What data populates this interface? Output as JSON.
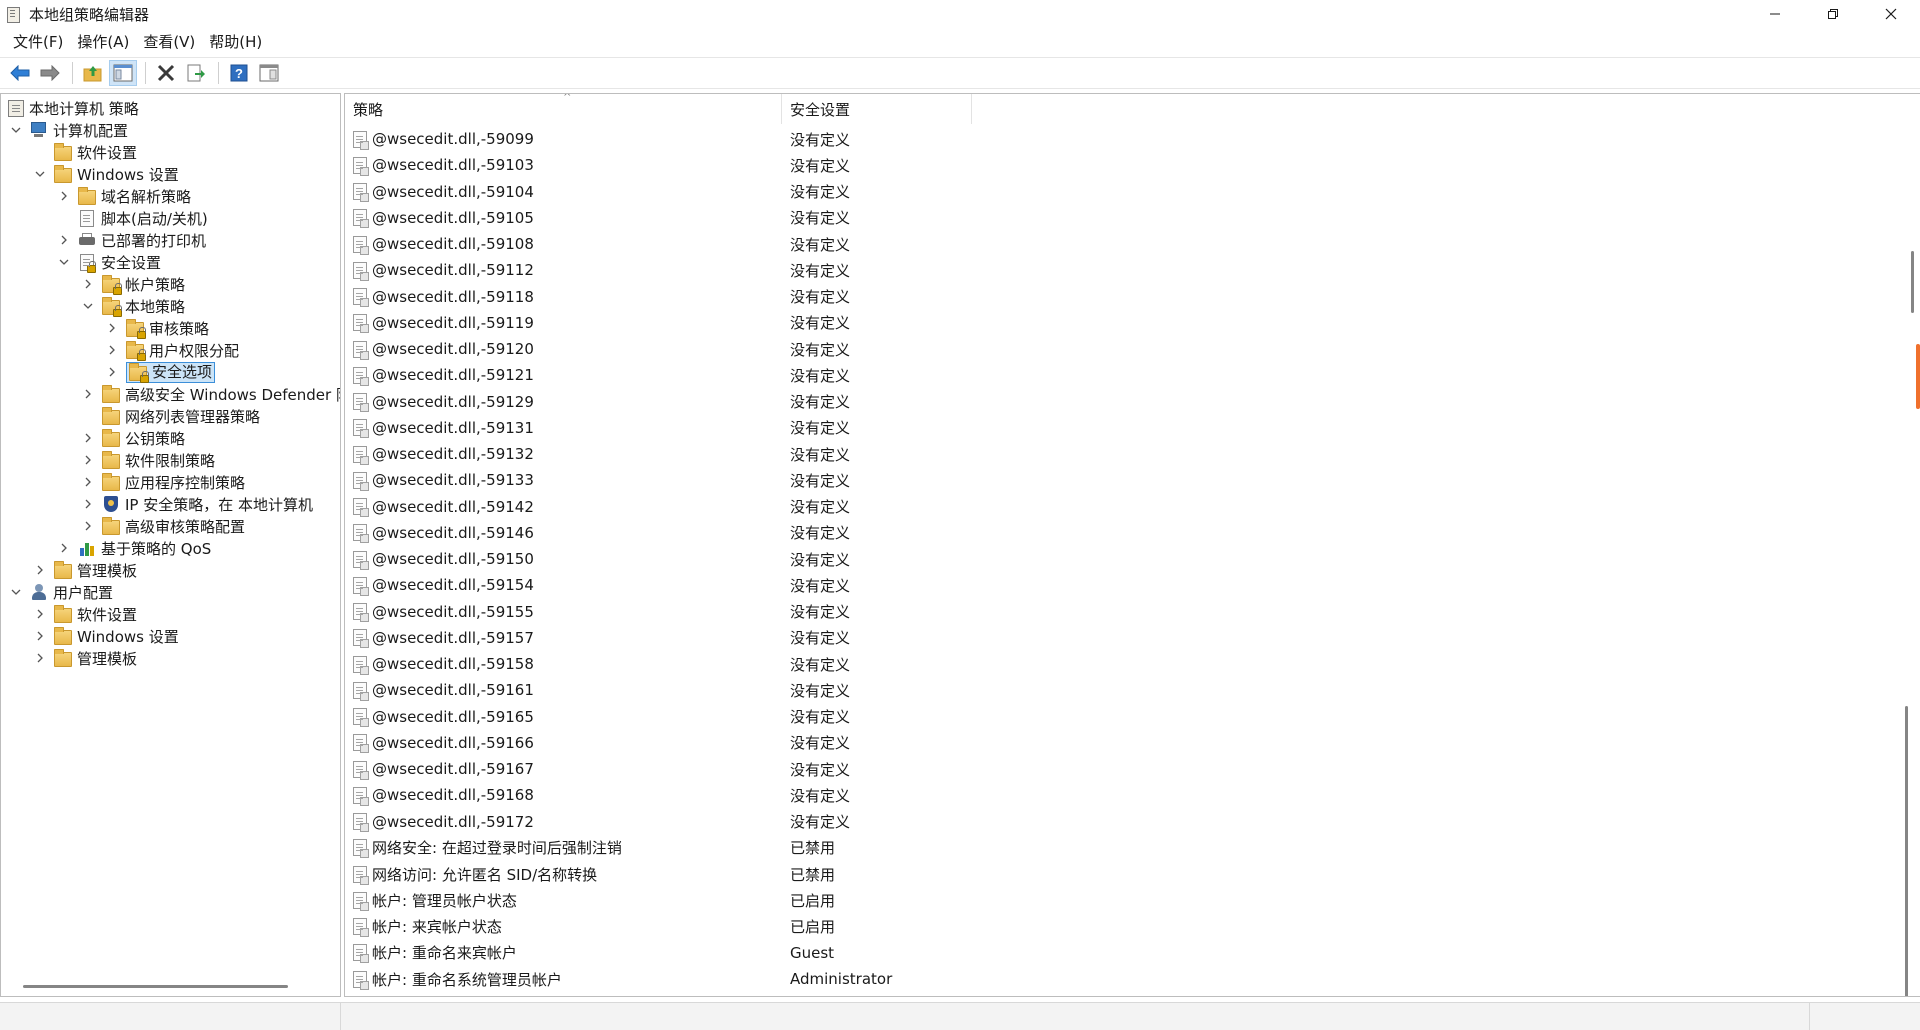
{
  "window": {
    "title": "本地组策略编辑器"
  },
  "menu": [
    {
      "label": "文件(F)"
    },
    {
      "label": "操作(A)"
    },
    {
      "label": "查看(V)"
    },
    {
      "label": "帮助(H)"
    }
  ],
  "toolbar": {
    "buttons": [
      "back-arrow-icon",
      "forward-arrow-icon",
      "up-folder-icon",
      "show-hide-tree-icon",
      "delete-icon",
      "export-list-icon",
      "help-icon",
      "properties-pane-icon"
    ]
  },
  "tree": {
    "items": [
      {
        "label": "本地计算机 策略"
      },
      {
        "label": "计算机配置"
      },
      {
        "label": "软件设置"
      },
      {
        "label": "Windows 设置"
      },
      {
        "label": "域名解析策略"
      },
      {
        "label": "脚本(启动/关机)"
      },
      {
        "label": "已部署的打印机"
      },
      {
        "label": "安全设置"
      },
      {
        "label": "帐户策略"
      },
      {
        "label": "本地策略"
      },
      {
        "label": "审核策略"
      },
      {
        "label": "用户权限分配"
      },
      {
        "label": "安全选项"
      },
      {
        "label": "高级安全 Windows Defender 防"
      },
      {
        "label": "网络列表管理器策略"
      },
      {
        "label": "公钥策略"
      },
      {
        "label": "软件限制策略"
      },
      {
        "label": "应用程序控制策略"
      },
      {
        "label": "IP 安全策略，在 本地计算机"
      },
      {
        "label": "高级审核策略配置"
      },
      {
        "label": "基于策略的 QoS"
      },
      {
        "label": "管理模板"
      },
      {
        "label": "用户配置"
      },
      {
        "label": "软件设置"
      },
      {
        "label": "Windows 设置"
      },
      {
        "label": "管理模板"
      }
    ]
  },
  "list": {
    "columns": {
      "policy": "策略",
      "setting": "安全设置"
    },
    "rows": [
      {
        "policy": "@wsecedit.dll,-59099",
        "setting": "没有定义"
      },
      {
        "policy": "@wsecedit.dll,-59103",
        "setting": "没有定义"
      },
      {
        "policy": "@wsecedit.dll,-59104",
        "setting": "没有定义"
      },
      {
        "policy": "@wsecedit.dll,-59105",
        "setting": "没有定义"
      },
      {
        "policy": "@wsecedit.dll,-59108",
        "setting": "没有定义"
      },
      {
        "policy": "@wsecedit.dll,-59112",
        "setting": "没有定义"
      },
      {
        "policy": "@wsecedit.dll,-59118",
        "setting": "没有定义"
      },
      {
        "policy": "@wsecedit.dll,-59119",
        "setting": "没有定义"
      },
      {
        "policy": "@wsecedit.dll,-59120",
        "setting": "没有定义"
      },
      {
        "policy": "@wsecedit.dll,-59121",
        "setting": "没有定义"
      },
      {
        "policy": "@wsecedit.dll,-59129",
        "setting": "没有定义"
      },
      {
        "policy": "@wsecedit.dll,-59131",
        "setting": "没有定义"
      },
      {
        "policy": "@wsecedit.dll,-59132",
        "setting": "没有定义"
      },
      {
        "policy": "@wsecedit.dll,-59133",
        "setting": "没有定义"
      },
      {
        "policy": "@wsecedit.dll,-59142",
        "setting": "没有定义"
      },
      {
        "policy": "@wsecedit.dll,-59146",
        "setting": "没有定义"
      },
      {
        "policy": "@wsecedit.dll,-59150",
        "setting": "没有定义"
      },
      {
        "policy": "@wsecedit.dll,-59154",
        "setting": "没有定义"
      },
      {
        "policy": "@wsecedit.dll,-59155",
        "setting": "没有定义"
      },
      {
        "policy": "@wsecedit.dll,-59157",
        "setting": "没有定义"
      },
      {
        "policy": "@wsecedit.dll,-59158",
        "setting": "没有定义"
      },
      {
        "policy": "@wsecedit.dll,-59161",
        "setting": "没有定义"
      },
      {
        "policy": "@wsecedit.dll,-59165",
        "setting": "没有定义"
      },
      {
        "policy": "@wsecedit.dll,-59166",
        "setting": "没有定义"
      },
      {
        "policy": "@wsecedit.dll,-59167",
        "setting": "没有定义"
      },
      {
        "policy": "@wsecedit.dll,-59168",
        "setting": "没有定义"
      },
      {
        "policy": "@wsecedit.dll,-59172",
        "setting": "没有定义"
      },
      {
        "policy": "网络安全: 在超过登录时间后强制注销",
        "setting": "已禁用"
      },
      {
        "policy": "网络访问: 允许匿名 SID/名称转换",
        "setting": "已禁用"
      },
      {
        "policy": "帐户: 管理员帐户状态",
        "setting": "已启用"
      },
      {
        "policy": "帐户: 来宾帐户状态",
        "setting": "已启用"
      },
      {
        "policy": "帐户: 重命名来宾帐户",
        "setting": "Guest"
      },
      {
        "policy": "帐户: 重命名系统管理员帐户",
        "setting": "Administrator"
      }
    ]
  },
  "colors": {
    "selection_bg": "#cce4f7",
    "selection_border": "#3c8fd9",
    "scroll_marker": "#f0702c"
  }
}
